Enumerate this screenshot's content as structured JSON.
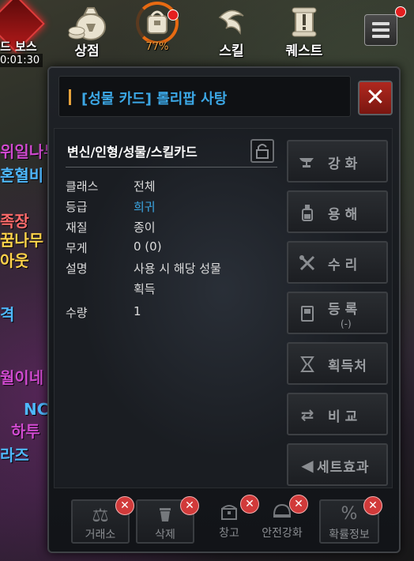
{
  "hud": {
    "boss_label": "드 보스",
    "boss_timer": "0:01:30",
    "menu": [
      {
        "icon": "money-bag-icon",
        "label": "상점"
      },
      {
        "icon": "bag-icon",
        "label": "77%"
      },
      {
        "icon": "skill-swirl-icon",
        "label": "스킬"
      },
      {
        "icon": "quest-scroll-icon",
        "label": "퀘스트"
      }
    ],
    "hamburger_icon": "menu-icon",
    "accent_orange": "#e76a12",
    "notify_red": "#e51f1f"
  },
  "chat_fragments": [
    "위일나무",
    "혼혈비",
    "족장",
    "꿈나무",
    "아웃",
    "격",
    "월이네",
    "NC",
    "하투",
    "라즈"
  ],
  "panel": {
    "title": "[성물 카드] 롤리팝 사탕",
    "title_color": "#3ca8e6",
    "close_icon": "close-icon",
    "item_name": "변신/인형/성물/스킬카드",
    "lock_icon": "lock-icon",
    "stats": [
      {
        "label": "클래스",
        "value": "전체"
      },
      {
        "label": "등급",
        "value": "희귀",
        "highlight": true
      },
      {
        "label": "재질",
        "value": "종이"
      },
      {
        "label": "무게",
        "value": "0 (0)"
      },
      {
        "label": "설명",
        "value": "사용 시 해당 성물",
        "value2": "획득"
      },
      {
        "label": "수량",
        "value": "1"
      }
    ],
    "side_buttons": [
      {
        "icon": "anvil-icon",
        "label": "강화"
      },
      {
        "icon": "potion-icon",
        "label": "용해"
      },
      {
        "icon": "tools-icon",
        "label": "수리"
      },
      {
        "icon": "book-icon",
        "label": "등록",
        "sub": "(-)"
      },
      {
        "icon": "hourglass-icon",
        "label": "획득처"
      },
      {
        "icon": "swap-arrows-icon",
        "label": "비교"
      },
      {
        "icon": "triangle-left-icon",
        "label": "세트효과"
      }
    ],
    "bottom_buttons": [
      {
        "icon": "scale-icon",
        "label": "거래소"
      },
      {
        "icon": "trash-icon",
        "label": "삭제"
      },
      {
        "icon": "chest-icon",
        "label": "창고"
      },
      {
        "icon": "helmet-icon",
        "label": "안전강화"
      },
      {
        "icon": "percent-icon",
        "label": "확률정보"
      }
    ]
  }
}
